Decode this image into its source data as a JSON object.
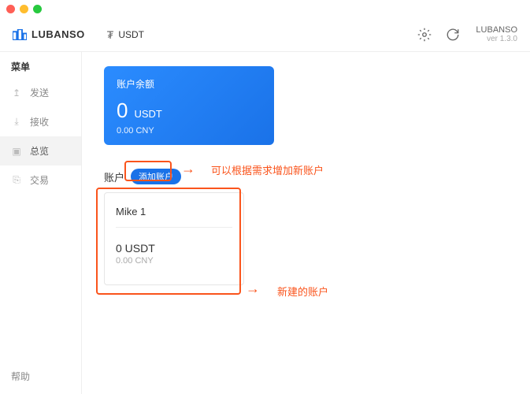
{
  "app": {
    "name": "LUBANSO",
    "brandUpper": "LUBANSO",
    "version": "ver 1.3.0"
  },
  "coin": {
    "symbol": "₮",
    "label": "USDT"
  },
  "sidebar": {
    "title": "菜单",
    "items": [
      {
        "icon": "↥",
        "label": "发送"
      },
      {
        "icon": "⤓",
        "label": "接收"
      },
      {
        "icon": "▣",
        "label": "总览"
      },
      {
        "icon": "⎘",
        "label": "交易"
      }
    ],
    "help": "帮助"
  },
  "balanceCard": {
    "title": "账户余额",
    "amount": "0",
    "unit": "USDT",
    "fiat": "0.00 CNY"
  },
  "accounts": {
    "title": "账户",
    "addLabel": "添加账户",
    "card": {
      "name": "Mike 1",
      "balance": "0 USDT",
      "fiat": "0.00 CNY"
    }
  },
  "annotations": {
    "addTip": "可以根据需求增加新账户",
    "cardTip": "新建的账户"
  }
}
